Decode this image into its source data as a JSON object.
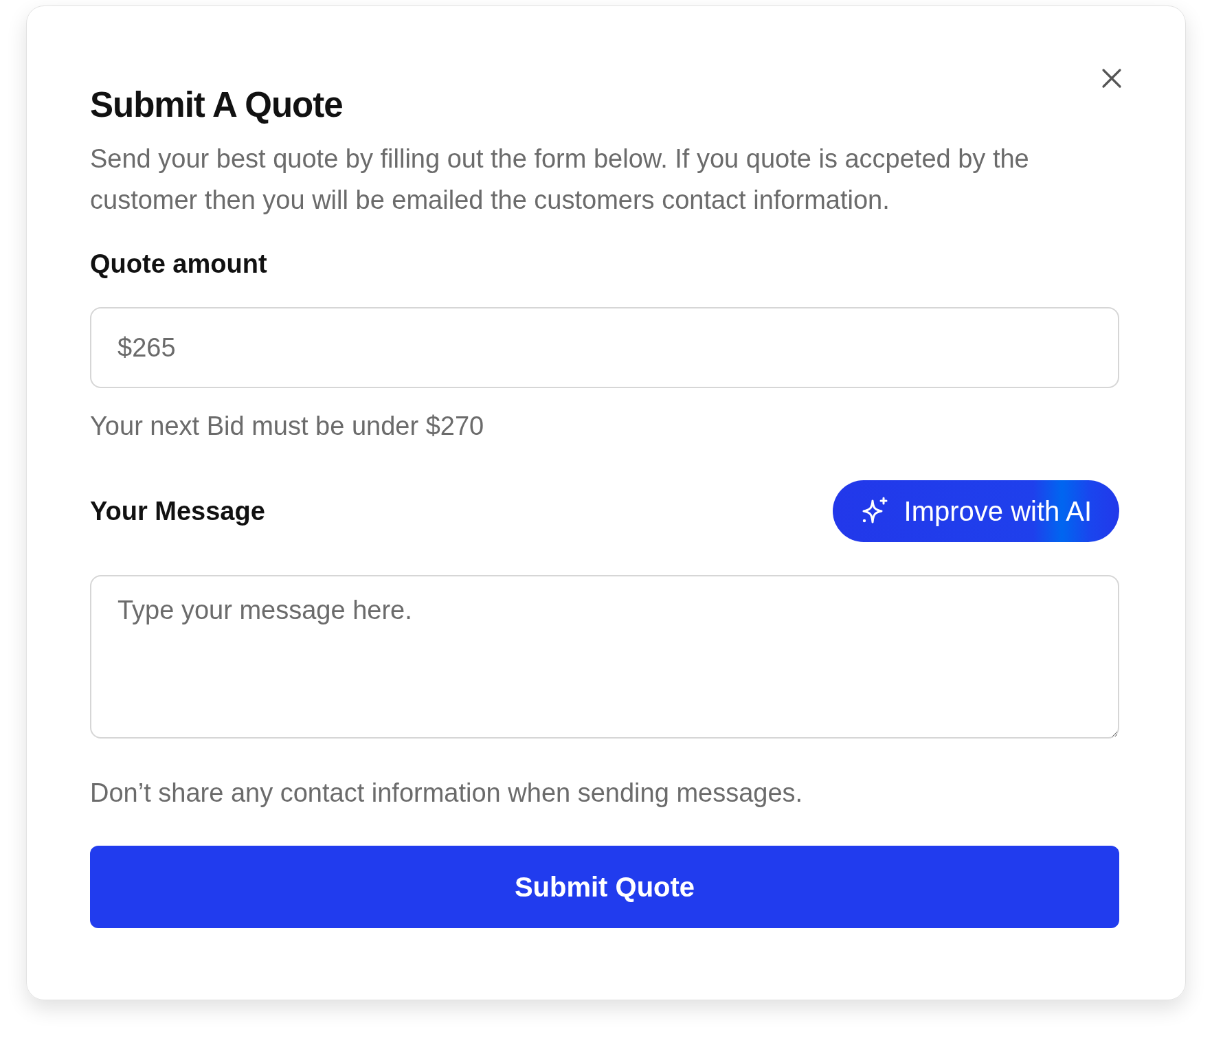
{
  "dialog": {
    "title": "Submit A Quote",
    "description": "Send your best quote by filling out the form below. If you quote is accpeted by the customer then you will be emailed the customers contact information."
  },
  "quote_amount": {
    "label": "Quote amount",
    "value": "$265",
    "hint": "Your next Bid must be under $270"
  },
  "message": {
    "label": "Your Message",
    "ai_button": "Improve with AI",
    "placeholder": "Type your message here.",
    "hint": "Don’t share any contact information when sending messages."
  },
  "submit_button": "Submit Quote"
}
